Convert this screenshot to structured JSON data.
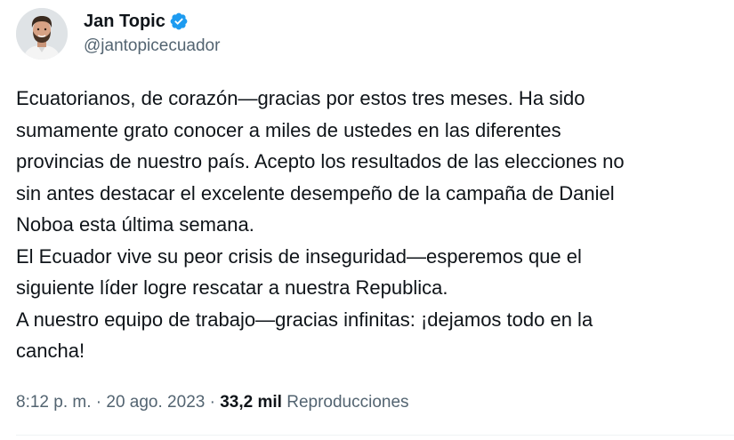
{
  "author": {
    "display_name": "Jan Topic",
    "handle": "@jantopicecuador",
    "verified": true,
    "avatar_icon": "profile-photo"
  },
  "tweet": {
    "lines": [
      "Ecuatorianos, de corazón—gracias por estos tres meses. Ha sido",
      "sumamente grato conocer a miles de ustedes en las diferentes",
      "provincias de nuestro país. Acepto los resultados de las elecciones no",
      "sin antes destacar el excelente desempeño de la campaña de Daniel",
      "Noboa esta última semana.",
      "El Ecuador vive su peor crisis de inseguridad—esperemos que el",
      "siguiente líder logre rescatar a nuestra Republica.",
      "A nuestro equipo de trabajo—gracias infinitas: ¡dejamos todo en la",
      "cancha!"
    ]
  },
  "meta": {
    "time": "8:12 p. m.",
    "separator": "·",
    "date": "20 ago. 2023",
    "views_count": "33,2 mil",
    "views_label": "Reproducciones"
  },
  "colors": {
    "text": "#0f1419",
    "secondary": "#536471",
    "verified_blue": "#1d9bf0",
    "divider": "#eff3f4"
  }
}
